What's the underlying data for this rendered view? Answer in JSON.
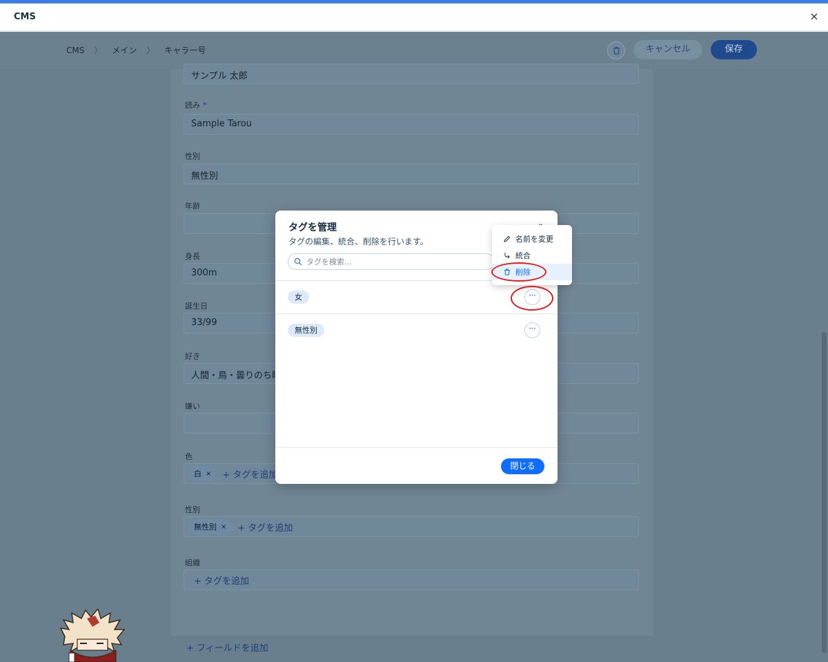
{
  "window": {
    "title": "CMS",
    "close_glyph": "×"
  },
  "header": {
    "breadcrumb": [
      "CMS",
      "メイン",
      "キャラー号"
    ],
    "breadcrumb_sep": "〉",
    "cancel_label": "キャンセル",
    "save_label": "保存"
  },
  "form": {
    "name_value": "サンプル 太郎",
    "fields": [
      {
        "label": "読み",
        "value": "Sample Tarou",
        "required_mark": "*"
      },
      {
        "label": "性別",
        "value": "無性別"
      },
      {
        "label": "年齢",
        "value": ""
      },
      {
        "label": "身長",
        "value": "300m"
      },
      {
        "label": "誕生日",
        "value": "33/99"
      },
      {
        "label": "好き",
        "value": "人間・鳥・曇りのち晴"
      },
      {
        "label": "嫌い",
        "value": ""
      }
    ],
    "color_field": {
      "label": "色",
      "chip": "白",
      "chip_x": "×",
      "add_tag": "+ タグを追加"
    },
    "gender_field": {
      "label": "性別",
      "chip": "無性別",
      "chip_x": "×",
      "add_tag": "+ タグを追加"
    },
    "org_field": {
      "label": "組織",
      "add_tag": "+ タグを追加"
    },
    "add_field": "+ フィールドを追加"
  },
  "modal": {
    "title": "タグを管理",
    "subtitle": "タグの編集、統合、削除を行います。",
    "collapse_glyph": "⌄",
    "search_placeholder": "タグを検索...",
    "tags": [
      "女",
      "無性別"
    ],
    "more_glyph": "···",
    "close_label": "閉じる"
  },
  "menu": {
    "items": [
      {
        "label": "名前を変更",
        "icon": "pencil-icon"
      },
      {
        "label": "統合",
        "icon": "merge-icon"
      },
      {
        "label": "削除",
        "icon": "trash-icon"
      }
    ]
  },
  "colors": {
    "accent": "#116dff",
    "annotation": "#e01c1c",
    "overlay": "#6a7f8e"
  }
}
